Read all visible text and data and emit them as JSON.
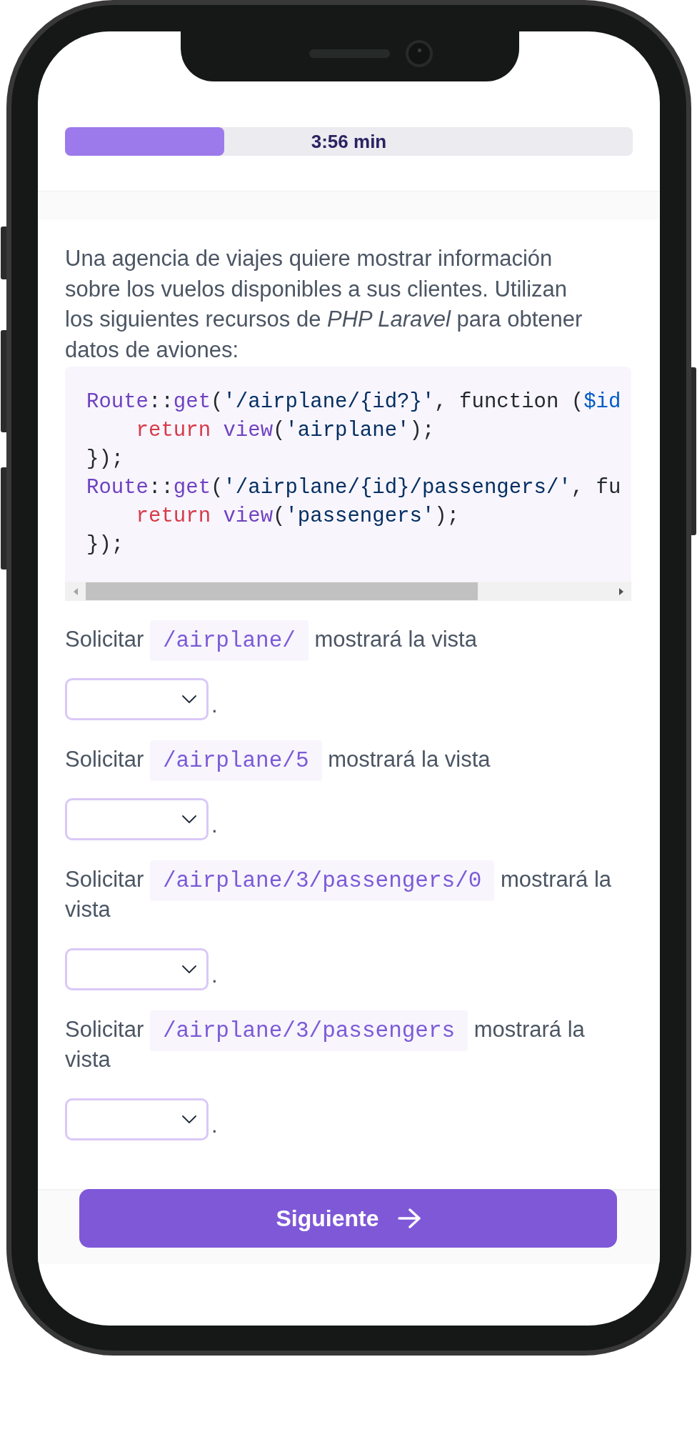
{
  "progress": {
    "level": 0.28,
    "label": "3:56 min"
  },
  "intro": "Una agencia de viajes quiere mostrar información sobre los vuelos disponibles a sus clientes. Utilizan los siguientes recursos de *PHP Laravel* para obtener datos de aviones:",
  "code_block": {
    "lines": [
      [
        {
          "kind": "class",
          "text": "Route"
        },
        {
          "kind": "plain",
          "text": "::"
        },
        {
          "kind": "function",
          "text": "get"
        },
        {
          "kind": "plain",
          "text": "("
        },
        {
          "kind": "string",
          "text": "'/airplane/{id?}'"
        },
        {
          "kind": "plain",
          "text": ", function ("
        },
        {
          "kind": "variable",
          "text": "$id"
        }
      ],
      [
        {
          "kind": "keyword",
          "text": "    return"
        },
        {
          "kind": "function",
          "text": " view"
        },
        {
          "kind": "plain",
          "text": "("
        },
        {
          "kind": "string",
          "text": "'airplane'"
        },
        {
          "kind": "plain",
          "text": ");"
        }
      ],
      [
        {
          "kind": "plain",
          "text": "});"
        }
      ],
      [
        {
          "kind": "class",
          "text": "Route"
        },
        {
          "kind": "plain",
          "text": "::"
        },
        {
          "kind": "function",
          "text": "get"
        },
        {
          "kind": "plain",
          "text": "("
        },
        {
          "kind": "string",
          "text": "'/airplane/{id}/passengers/'"
        },
        {
          "kind": "plain",
          "text": ", fu"
        }
      ],
      [
        {
          "kind": "keyword",
          "text": "    return"
        },
        {
          "kind": "function",
          "text": " view"
        },
        {
          "kind": "plain",
          "text": "("
        },
        {
          "kind": "string",
          "text": "'passengers'"
        },
        {
          "kind": "plain",
          "text": ");"
        }
      ],
      [
        {
          "kind": "plain",
          "text": "});"
        }
      ]
    ]
  },
  "questions": [
    {
      "prefix": "Solicitar",
      "code": "/airplane/",
      "suffix": "mostrará la vista",
      "ending": "."
    },
    {
      "prefix": "Solicitar",
      "code": "/airplane/5",
      "suffix": "mostrará la vista",
      "ending": "."
    },
    {
      "prefix": "Solicitar",
      "code": "/airplane/3/passengers/0",
      "suffix": "mostrará la vista",
      "ending": "."
    },
    {
      "prefix": "Solicitar",
      "code": "/airplane/3/passengers",
      "suffix": "mostrará la vista",
      "ending": "."
    }
  ],
  "next_button": {
    "label": "Siguiente"
  }
}
